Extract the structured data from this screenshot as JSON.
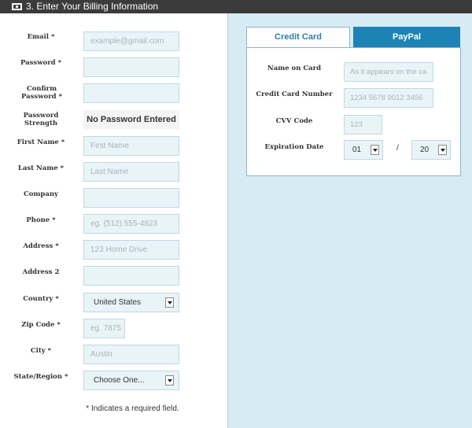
{
  "header": {
    "title": "3. Enter Your Billing Information",
    "icon": "credit-card-icon"
  },
  "billing_form": {
    "email": {
      "label": "Email *",
      "placeholder": "example@gmail.com"
    },
    "password": {
      "label": "Password *",
      "value": ""
    },
    "confirm_password": {
      "label": "Confirm Password *",
      "value": ""
    },
    "password_strength": {
      "label": "Password Strength",
      "value": "No Password Entered"
    },
    "first_name": {
      "label": "First Name *",
      "placeholder": "First Name"
    },
    "last_name": {
      "label": "Last Name *",
      "placeholder": "Last Name"
    },
    "company": {
      "label": "Company",
      "value": ""
    },
    "phone": {
      "label": "Phone *",
      "placeholder": "eg. (512) 555-4823"
    },
    "address": {
      "label": "Address *",
      "placeholder": "123 Home Drive"
    },
    "address2": {
      "label": "Address 2",
      "value": ""
    },
    "country": {
      "label": "Country *",
      "selected": "United States"
    },
    "zip": {
      "label": "Zip Code *",
      "placeholder": "eg. 7875"
    },
    "city": {
      "label": "City *",
      "placeholder": "Austin"
    },
    "state": {
      "label": "State/Region *",
      "selected": "Choose One..."
    },
    "required_note": "* Indicates a required field."
  },
  "payment": {
    "tabs": {
      "credit_card": "Credit Card",
      "paypal": "PayPal"
    },
    "name_on_card": {
      "label": "Name on Card",
      "placeholder": "As it appears on the ca"
    },
    "card_number": {
      "label": "Credit Card Number",
      "placeholder": "1234 5678 9012 3456"
    },
    "cvv": {
      "label": "CVV Code",
      "placeholder": "123"
    },
    "expiration": {
      "label": "Expiration Date",
      "month": "01",
      "year": "20",
      "separator": "/"
    }
  },
  "colors": {
    "header_bg": "#3b3b3b",
    "input_bg": "#e9f4f8",
    "panel_bg": "#d7ebf4",
    "accent": "#1c83b4"
  }
}
